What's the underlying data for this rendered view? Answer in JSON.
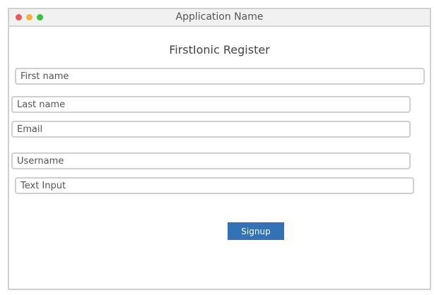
{
  "window": {
    "title": "Application Name",
    "controls": [
      "close-button",
      "minimize-button",
      "maximize-button"
    ],
    "control_colors": {
      "close": "#e95b57",
      "minimize": "#f3b33b",
      "maximize": "#36c13f"
    }
  },
  "form": {
    "heading": "FirstIonic Register",
    "fields": {
      "first_name": {
        "placeholder": "First name",
        "value": ""
      },
      "last_name": {
        "placeholder": "Last name",
        "value": ""
      },
      "email": {
        "placeholder": "Email",
        "value": ""
      },
      "username": {
        "placeholder": "Username",
        "value": ""
      },
      "text_input": {
        "placeholder": "Text Input",
        "value": ""
      }
    },
    "signup_label": "Signup",
    "signup_color": "#3372b5"
  }
}
